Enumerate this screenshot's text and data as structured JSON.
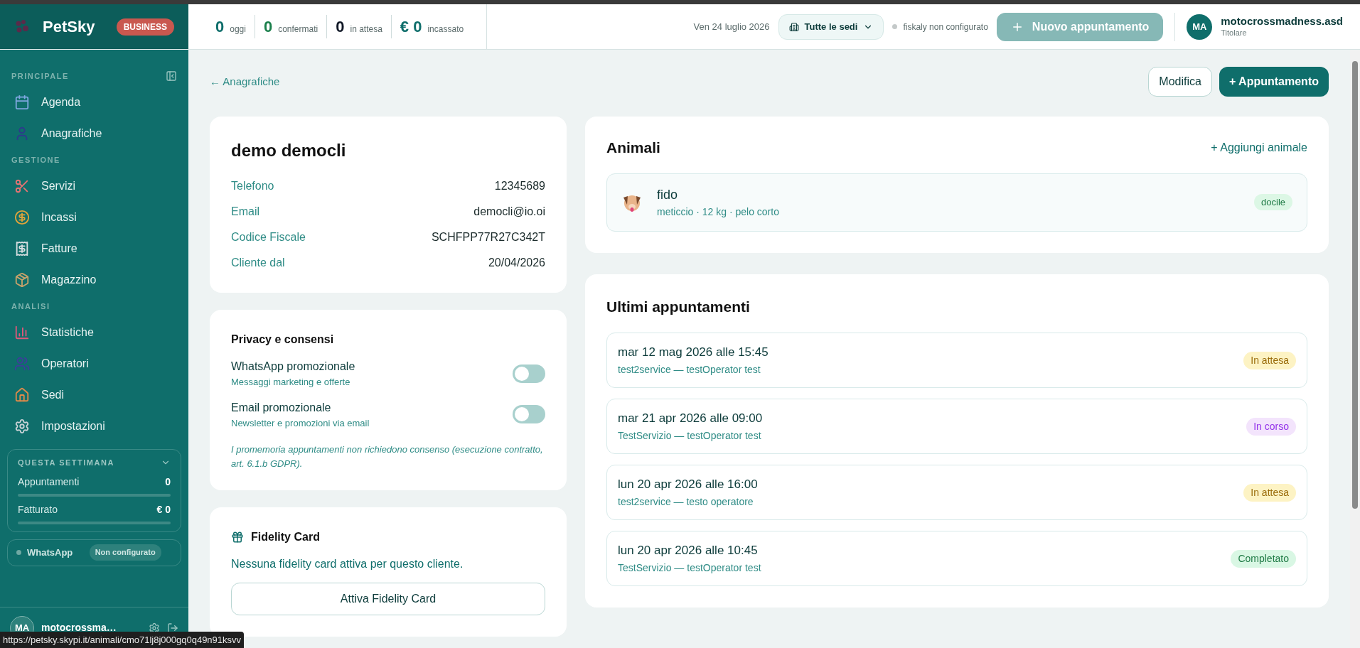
{
  "brand": {
    "name": "PetSky",
    "badge": "BUSINESS"
  },
  "sidebar": {
    "sections": [
      {
        "title": "PRINCIPALE",
        "items": [
          {
            "label": "Agenda",
            "kind": "calendar"
          },
          {
            "label": "Anagrafiche",
            "kind": "person"
          }
        ]
      },
      {
        "title": "GESTIONE",
        "items": [
          {
            "label": "Servizi",
            "kind": "scissors"
          },
          {
            "label": "Incassi",
            "kind": "moneybag"
          },
          {
            "label": "Fatture",
            "kind": "receipt"
          },
          {
            "label": "Magazzino",
            "kind": "package"
          }
        ]
      },
      {
        "title": "ANALISI",
        "items": [
          {
            "label": "Statistiche",
            "kind": "chart"
          },
          {
            "label": "Operatori",
            "kind": "people"
          },
          {
            "label": "Sedi",
            "kind": "house"
          },
          {
            "label": "Impostazioni",
            "kind": "gear"
          }
        ]
      }
    ],
    "week": {
      "title": "QUESTA SETTIMANA",
      "rows": [
        {
          "label": "Appuntamenti",
          "value": "0",
          "level": 0
        },
        {
          "label": "Fatturato",
          "value": "€ 0",
          "level": 0
        }
      ]
    },
    "whatsapp": {
      "label": "WhatsApp",
      "status": "Non configurato"
    },
    "user": {
      "initials": "MA",
      "name": "motocrossma…"
    }
  },
  "topbar": {
    "stats": [
      {
        "value": "0",
        "label": "oggi",
        "color": "#0f6e6b"
      },
      {
        "value": "0",
        "label": "confermati",
        "color": "#1a7f4b"
      },
      {
        "value": "0",
        "label": "in attesa",
        "color": "#111827"
      },
      {
        "value": "€ 0",
        "label": "incassato",
        "color": "#0f6e6b"
      }
    ],
    "date": "Ven 24 luglio 2026",
    "location": "Tutte le sedi",
    "fiscal": "fiskaly non configurato",
    "new_button": "Nuovo appuntamento",
    "user": {
      "initials": "MA",
      "name": "motocrossmadness.asd",
      "role": "Titolare"
    }
  },
  "back_link": "← Anagrafiche",
  "actions": [
    "Modifica",
    "+ Appuntamento"
  ],
  "client": {
    "name": "demo democli",
    "fields": [
      {
        "label": "Telefono",
        "value": "12345689"
      },
      {
        "label": "Email",
        "value": "democli@io.oi"
      },
      {
        "label": "Codice Fiscale",
        "value": "SCHFPP77R27C342T"
      },
      {
        "label": "Cliente dal",
        "value": "20/04/2026"
      }
    ]
  },
  "privacy": {
    "title": "Privacy e consensi",
    "toggles": [
      {
        "label": "WhatsApp promozionale",
        "hint": "Messaggi marketing e offerte",
        "on": false
      },
      {
        "label": "Email promozionale",
        "hint": "Newsletter e promozioni via email",
        "on": false
      }
    ],
    "note": "I promemoria appuntamenti non richiedono consenso (esecuzione contratto, art. 6.1.b GDPR)."
  },
  "fidelity": {
    "title": "Fidelity Card",
    "text": "Nessuna fidelity card attiva per questo cliente.",
    "button": "Attiva Fidelity Card"
  },
  "animals": {
    "title": "Animali",
    "add": "+ Aggiungi animale",
    "items": [
      {
        "name": "fido",
        "details": "meticcio · 12 kg · pelo corto",
        "tag": "docile"
      }
    ]
  },
  "appointments": {
    "title": "Ultimi appuntamenti",
    "items": [
      {
        "when": "mar 12 mag 2026 alle 15:45",
        "what": "test2service — testOperator test",
        "status": "In attesa",
        "kind": "pending"
      },
      {
        "when": "mar 21 apr 2026 alle 09:00",
        "what": "TestServizio — testOperator test",
        "status": "In corso",
        "kind": "progress"
      },
      {
        "when": "lun 20 apr 2026 alle 16:00",
        "what": "test2service — testo operatore",
        "status": "In attesa",
        "kind": "pending"
      },
      {
        "when": "lun 20 apr 2026 alle 10:45",
        "what": "TestServizio — testOperator test",
        "status": "Completato",
        "kind": "done"
      }
    ]
  },
  "status_url": "https://petsky.skypi.it/animali/cmo71lj8j000gq0q49n91ksvv"
}
